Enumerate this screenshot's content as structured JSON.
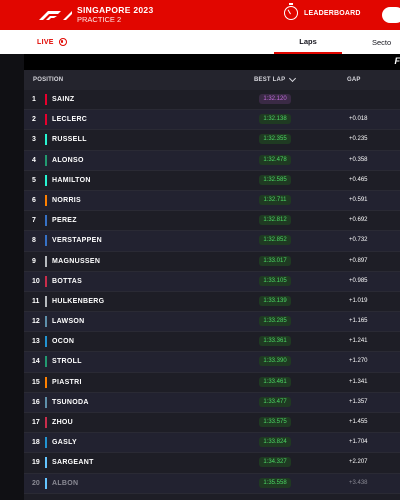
{
  "header": {
    "event_title": "SINGAPORE 2023",
    "session": "PRACTICE 2",
    "leaderboard_label": "LEADERBOARD"
  },
  "tabs": {
    "live_label": "LIVE",
    "laps_label": "Laps",
    "sectors_label": "Secto"
  },
  "substrip": {
    "logo_fragment": "F"
  },
  "table": {
    "headers": {
      "position": "POSITION",
      "best_lap": "BEST LAP",
      "gap": "GAP"
    },
    "rows": [
      {
        "pos": "1",
        "name": "SAINZ",
        "team_color": "#e8002d",
        "best_lap": "1:32.120",
        "lap_style": "purple",
        "gap": ""
      },
      {
        "pos": "2",
        "name": "LECLERC",
        "team_color": "#e8002d",
        "best_lap": "1:32.138",
        "lap_style": "green",
        "gap": "+0.018"
      },
      {
        "pos": "3",
        "name": "RUSSELL",
        "team_color": "#27f4d2",
        "best_lap": "1:32.355",
        "lap_style": "green",
        "gap": "+0.235"
      },
      {
        "pos": "4",
        "name": "ALONSO",
        "team_color": "#229971",
        "best_lap": "1:32.478",
        "lap_style": "green",
        "gap": "+0.358"
      },
      {
        "pos": "5",
        "name": "HAMILTON",
        "team_color": "#27f4d2",
        "best_lap": "1:32.585",
        "lap_style": "green",
        "gap": "+0.465"
      },
      {
        "pos": "6",
        "name": "NORRIS",
        "team_color": "#ff8000",
        "best_lap": "1:32.711",
        "lap_style": "green",
        "gap": "+0.591"
      },
      {
        "pos": "7",
        "name": "PEREZ",
        "team_color": "#3671c6",
        "best_lap": "1:32.812",
        "lap_style": "green",
        "gap": "+0.692"
      },
      {
        "pos": "8",
        "name": "VERSTAPPEN",
        "team_color": "#3671c6",
        "best_lap": "1:32.852",
        "lap_style": "green",
        "gap": "+0.732"
      },
      {
        "pos": "9",
        "name": "MAGNUSSEN",
        "team_color": "#b6babd",
        "best_lap": "1:33.017",
        "lap_style": "green",
        "gap": "+0.897"
      },
      {
        "pos": "10",
        "name": "BOTTAS",
        "team_color": "#c92d4b",
        "best_lap": "1:33.105",
        "lap_style": "green",
        "gap": "+0.985"
      },
      {
        "pos": "11",
        "name": "HULKENBERG",
        "team_color": "#b6babd",
        "best_lap": "1:33.139",
        "lap_style": "green",
        "gap": "+1.019"
      },
      {
        "pos": "12",
        "name": "LAWSON",
        "team_color": "#5e8faa",
        "best_lap": "1:33.285",
        "lap_style": "green",
        "gap": "+1.165"
      },
      {
        "pos": "13",
        "name": "OCON",
        "team_color": "#2293d1",
        "best_lap": "1:33.361",
        "lap_style": "green",
        "gap": "+1.241"
      },
      {
        "pos": "14",
        "name": "STROLL",
        "team_color": "#229971",
        "best_lap": "1:33.390",
        "lap_style": "green",
        "gap": "+1.270"
      },
      {
        "pos": "15",
        "name": "PIASTRI",
        "team_color": "#ff8000",
        "best_lap": "1:33.461",
        "lap_style": "green",
        "gap": "+1.341"
      },
      {
        "pos": "16",
        "name": "TSUNODA",
        "team_color": "#5e8faa",
        "best_lap": "1:33.477",
        "lap_style": "green",
        "gap": "+1.357"
      },
      {
        "pos": "17",
        "name": "ZHOU",
        "team_color": "#c92d4b",
        "best_lap": "1:33.575",
        "lap_style": "green",
        "gap": "+1.455"
      },
      {
        "pos": "18",
        "name": "GASLY",
        "team_color": "#2293d1",
        "best_lap": "1:33.824",
        "lap_style": "green",
        "gap": "+1.704"
      },
      {
        "pos": "19",
        "name": "SARGEANT",
        "team_color": "#64c4ff",
        "best_lap": "1:34.327",
        "lap_style": "green",
        "gap": "+2.207"
      },
      {
        "pos": "20",
        "name": "ALBON",
        "team_color": "#64c4ff",
        "best_lap": "1:35.558",
        "lap_style": "green",
        "gap": "+3.438",
        "faded": true
      }
    ]
  },
  "colors": {
    "brand_red": "#e10600",
    "purple_lap_bg": "#3a2a45",
    "purple_lap_text": "#c26bdc",
    "green_lap_bg": "#1f3a22",
    "green_lap_text": "#4cd964"
  },
  "icons": {
    "logo": "f1-logo",
    "leaderboard": "stopwatch-icon",
    "live": "live-dot-icon",
    "sort": "chevron-down-icon"
  }
}
